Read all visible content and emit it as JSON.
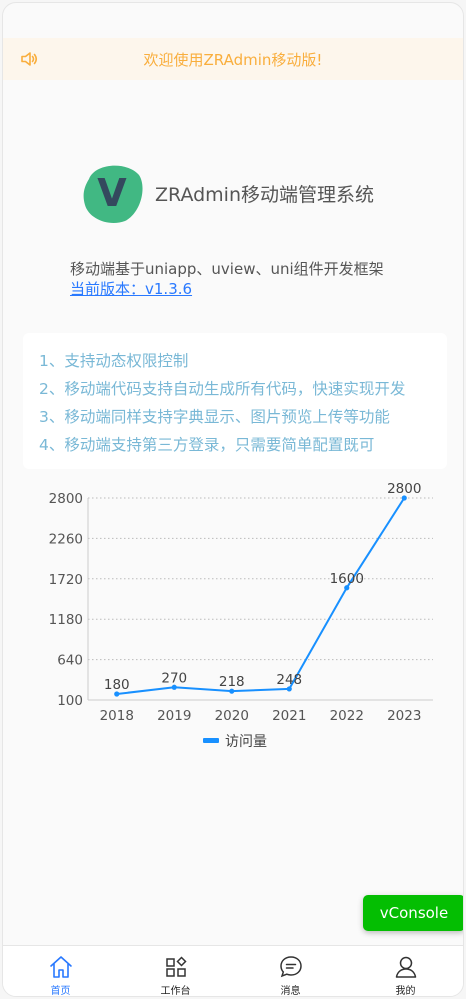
{
  "notice": {
    "text": "欢迎使用ZRAdmin移动版!",
    "icon": "volume-icon",
    "color": "#f9ae3d"
  },
  "header": {
    "logo_letter": "V",
    "title": "ZRAdmin移动端管理系统",
    "description": "移动端基于uniapp、uview、uni组件开发框架",
    "version": "当前版本：v1.3.6"
  },
  "features": [
    "1、支持动态权限控制",
    "2、移动端代码支持自动生成所有代码，快速实现开发",
    "3、移动端同样支持字典显示、图片预览上传等功能",
    "4、移动端支持第三方登录，只需要简单配置既可"
  ],
  "chart_data": {
    "type": "line",
    "categories": [
      "2018",
      "2019",
      "2020",
      "2021",
      "2022",
      "2023"
    ],
    "series": [
      {
        "name": "访问量",
        "values": [
          180,
          270,
          218,
          248,
          1600,
          2800
        ],
        "color": "#1890ff"
      }
    ],
    "yticks": [
      "100",
      "640",
      "1180",
      "1720",
      "2260",
      "2800"
    ],
    "ylim": [
      100,
      2800
    ],
    "grid": true,
    "legend": "bottom"
  },
  "vconsole": {
    "label": "vConsole"
  },
  "tabbar": [
    {
      "label": "首页",
      "icon": "home-icon",
      "active": true
    },
    {
      "label": "工作台",
      "icon": "grid-icon",
      "active": false
    },
    {
      "label": "消息",
      "icon": "message-icon",
      "active": false
    },
    {
      "label": "我的",
      "icon": "user-icon",
      "active": false
    }
  ],
  "colors": {
    "accent": "#2979ff",
    "logo_bg": "#41b883",
    "logo_letter": "#34495e"
  }
}
